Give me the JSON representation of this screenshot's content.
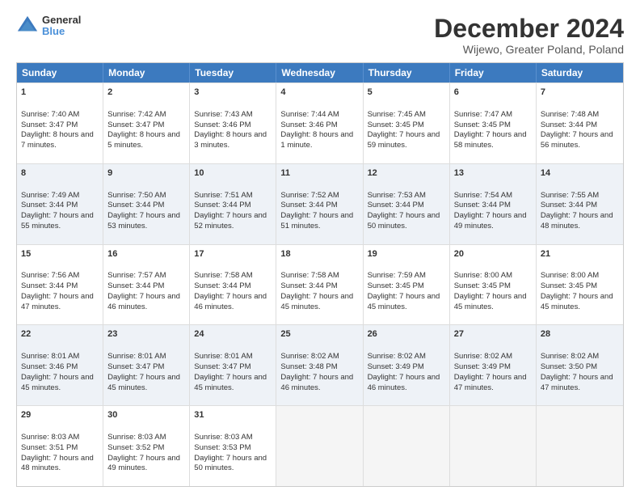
{
  "logo": {
    "line1": "General",
    "line2": "Blue"
  },
  "title": "December 2024",
  "subtitle": "Wijewo, Greater Poland, Poland",
  "days": [
    "Sunday",
    "Monday",
    "Tuesday",
    "Wednesday",
    "Thursday",
    "Friday",
    "Saturday"
  ],
  "weeks": [
    [
      {
        "num": "1",
        "sunrise": "Sunrise: 7:40 AM",
        "sunset": "Sunset: 3:47 PM",
        "daylight": "Daylight: 8 hours and 7 minutes."
      },
      {
        "num": "2",
        "sunrise": "Sunrise: 7:42 AM",
        "sunset": "Sunset: 3:47 PM",
        "daylight": "Daylight: 8 hours and 5 minutes."
      },
      {
        "num": "3",
        "sunrise": "Sunrise: 7:43 AM",
        "sunset": "Sunset: 3:46 PM",
        "daylight": "Daylight: 8 hours and 3 minutes."
      },
      {
        "num": "4",
        "sunrise": "Sunrise: 7:44 AM",
        "sunset": "Sunset: 3:46 PM",
        "daylight": "Daylight: 8 hours and 1 minute."
      },
      {
        "num": "5",
        "sunrise": "Sunrise: 7:45 AM",
        "sunset": "Sunset: 3:45 PM",
        "daylight": "Daylight: 7 hours and 59 minutes."
      },
      {
        "num": "6",
        "sunrise": "Sunrise: 7:47 AM",
        "sunset": "Sunset: 3:45 PM",
        "daylight": "Daylight: 7 hours and 58 minutes."
      },
      {
        "num": "7",
        "sunrise": "Sunrise: 7:48 AM",
        "sunset": "Sunset: 3:44 PM",
        "daylight": "Daylight: 7 hours and 56 minutes."
      }
    ],
    [
      {
        "num": "8",
        "sunrise": "Sunrise: 7:49 AM",
        "sunset": "Sunset: 3:44 PM",
        "daylight": "Daylight: 7 hours and 55 minutes."
      },
      {
        "num": "9",
        "sunrise": "Sunrise: 7:50 AM",
        "sunset": "Sunset: 3:44 PM",
        "daylight": "Daylight: 7 hours and 53 minutes."
      },
      {
        "num": "10",
        "sunrise": "Sunrise: 7:51 AM",
        "sunset": "Sunset: 3:44 PM",
        "daylight": "Daylight: 7 hours and 52 minutes."
      },
      {
        "num": "11",
        "sunrise": "Sunrise: 7:52 AM",
        "sunset": "Sunset: 3:44 PM",
        "daylight": "Daylight: 7 hours and 51 minutes."
      },
      {
        "num": "12",
        "sunrise": "Sunrise: 7:53 AM",
        "sunset": "Sunset: 3:44 PM",
        "daylight": "Daylight: 7 hours and 50 minutes."
      },
      {
        "num": "13",
        "sunrise": "Sunrise: 7:54 AM",
        "sunset": "Sunset: 3:44 PM",
        "daylight": "Daylight: 7 hours and 49 minutes."
      },
      {
        "num": "14",
        "sunrise": "Sunrise: 7:55 AM",
        "sunset": "Sunset: 3:44 PM",
        "daylight": "Daylight: 7 hours and 48 minutes."
      }
    ],
    [
      {
        "num": "15",
        "sunrise": "Sunrise: 7:56 AM",
        "sunset": "Sunset: 3:44 PM",
        "daylight": "Daylight: 7 hours and 47 minutes."
      },
      {
        "num": "16",
        "sunrise": "Sunrise: 7:57 AM",
        "sunset": "Sunset: 3:44 PM",
        "daylight": "Daylight: 7 hours and 46 minutes."
      },
      {
        "num": "17",
        "sunrise": "Sunrise: 7:58 AM",
        "sunset": "Sunset: 3:44 PM",
        "daylight": "Daylight: 7 hours and 46 minutes."
      },
      {
        "num": "18",
        "sunrise": "Sunrise: 7:58 AM",
        "sunset": "Sunset: 3:44 PM",
        "daylight": "Daylight: 7 hours and 45 minutes."
      },
      {
        "num": "19",
        "sunrise": "Sunrise: 7:59 AM",
        "sunset": "Sunset: 3:45 PM",
        "daylight": "Daylight: 7 hours and 45 minutes."
      },
      {
        "num": "20",
        "sunrise": "Sunrise: 8:00 AM",
        "sunset": "Sunset: 3:45 PM",
        "daylight": "Daylight: 7 hours and 45 minutes."
      },
      {
        "num": "21",
        "sunrise": "Sunrise: 8:00 AM",
        "sunset": "Sunset: 3:45 PM",
        "daylight": "Daylight: 7 hours and 45 minutes."
      }
    ],
    [
      {
        "num": "22",
        "sunrise": "Sunrise: 8:01 AM",
        "sunset": "Sunset: 3:46 PM",
        "daylight": "Daylight: 7 hours and 45 minutes."
      },
      {
        "num": "23",
        "sunrise": "Sunrise: 8:01 AM",
        "sunset": "Sunset: 3:47 PM",
        "daylight": "Daylight: 7 hours and 45 minutes."
      },
      {
        "num": "24",
        "sunrise": "Sunrise: 8:01 AM",
        "sunset": "Sunset: 3:47 PM",
        "daylight": "Daylight: 7 hours and 45 minutes."
      },
      {
        "num": "25",
        "sunrise": "Sunrise: 8:02 AM",
        "sunset": "Sunset: 3:48 PM",
        "daylight": "Daylight: 7 hours and 46 minutes."
      },
      {
        "num": "26",
        "sunrise": "Sunrise: 8:02 AM",
        "sunset": "Sunset: 3:49 PM",
        "daylight": "Daylight: 7 hours and 46 minutes."
      },
      {
        "num": "27",
        "sunrise": "Sunrise: 8:02 AM",
        "sunset": "Sunset: 3:49 PM",
        "daylight": "Daylight: 7 hours and 47 minutes."
      },
      {
        "num": "28",
        "sunrise": "Sunrise: 8:02 AM",
        "sunset": "Sunset: 3:50 PM",
        "daylight": "Daylight: 7 hours and 47 minutes."
      }
    ],
    [
      {
        "num": "29",
        "sunrise": "Sunrise: 8:03 AM",
        "sunset": "Sunset: 3:51 PM",
        "daylight": "Daylight: 7 hours and 48 minutes."
      },
      {
        "num": "30",
        "sunrise": "Sunrise: 8:03 AM",
        "sunset": "Sunset: 3:52 PM",
        "daylight": "Daylight: 7 hours and 49 minutes."
      },
      {
        "num": "31",
        "sunrise": "Sunrise: 8:03 AM",
        "sunset": "Sunset: 3:53 PM",
        "daylight": "Daylight: 7 hours and 50 minutes."
      },
      null,
      null,
      null,
      null
    ]
  ]
}
